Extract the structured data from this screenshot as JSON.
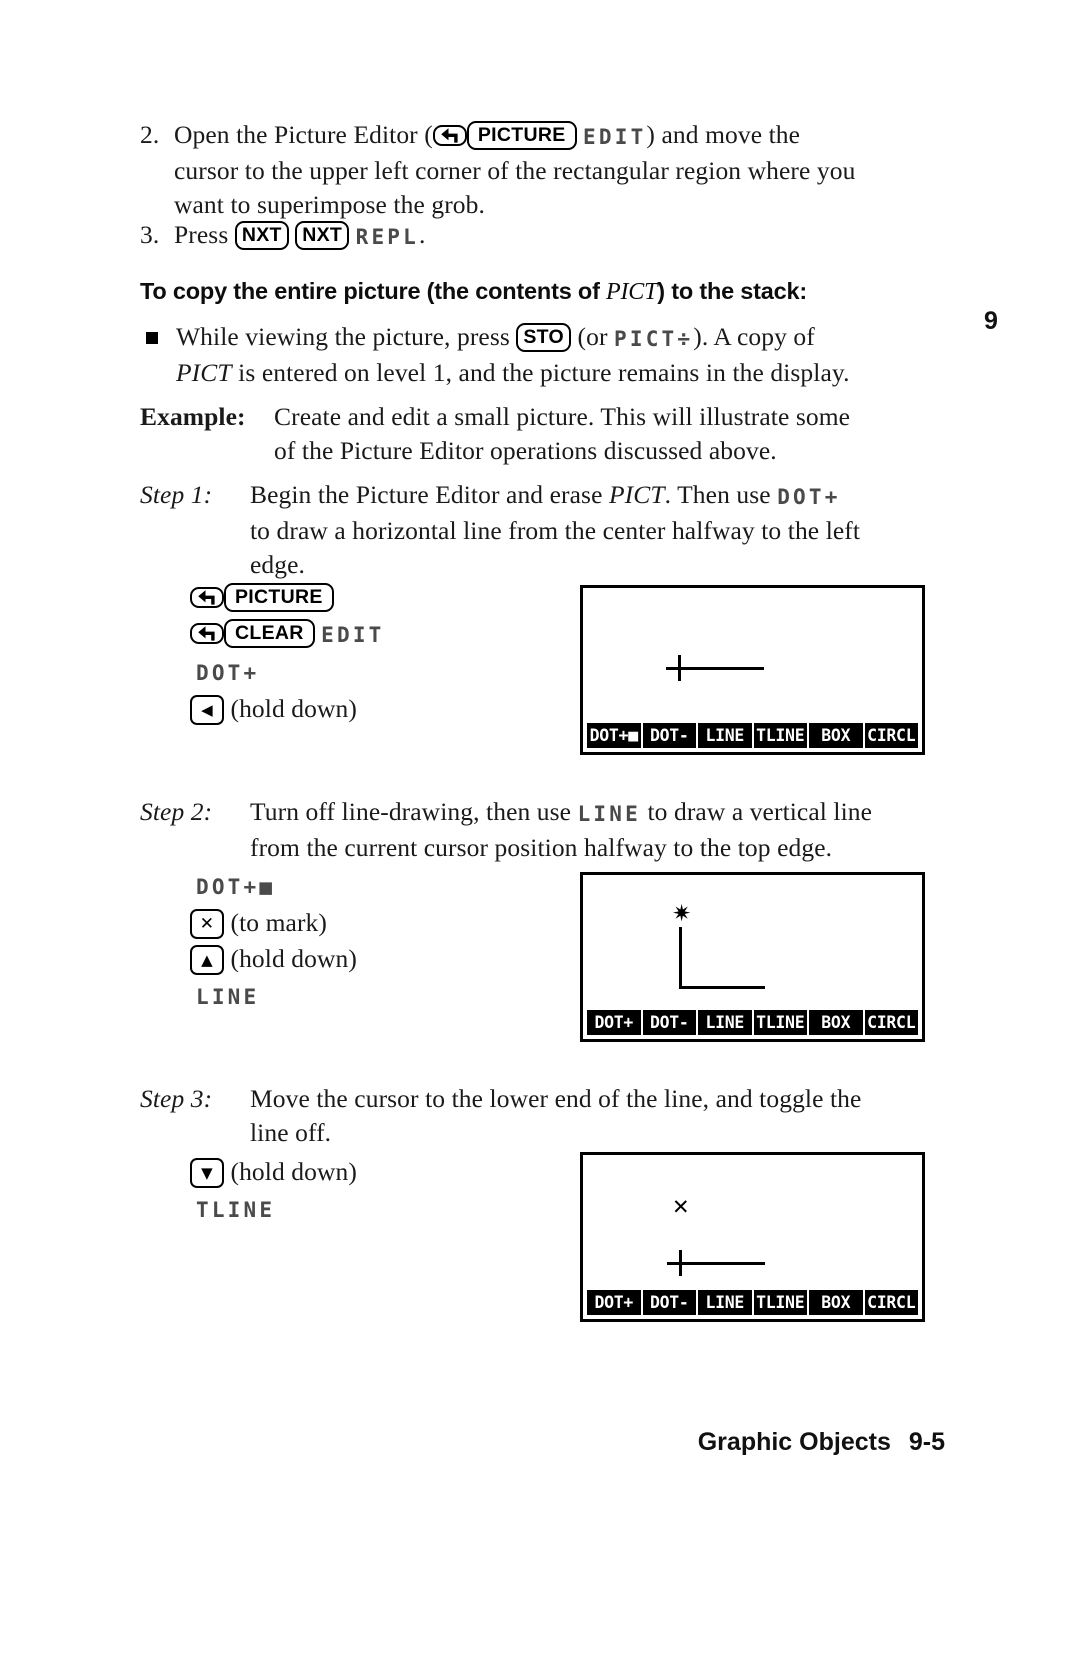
{
  "document": {
    "page_marker": "9",
    "footer_title": "Graphic Objects",
    "footer_page": "9-5"
  },
  "steps_top": {
    "item2": {
      "number": "2.",
      "text_before": "Open the Picture Editor (",
      "key_shift": "left-shift",
      "key_picture": "PICTURE",
      "soft_edit": "EDIT",
      "text_after": ") and move the",
      "line2": "cursor to the upper left corner of the rectangular region where you",
      "line3": "want to superimpose the grob."
    },
    "item3": {
      "number": "3.",
      "text_before": "Press",
      "key_nxt_1": "NXT",
      "key_nxt_2": "NXT",
      "soft_repl": "REPL",
      "text_after": "."
    }
  },
  "heading": {
    "part1": "To copy the entire picture (the contents of ",
    "italic": "PICT",
    "part2": ") to the stack:"
  },
  "bullet": {
    "line1_a": "While viewing the picture, press",
    "key_sto": "STO",
    "line1_b": "(or",
    "soft_pict_store": "PICT",
    "soft_pict_store_arrow": "÷",
    "line1_c": "). A copy of",
    "line2_italic": "PICT",
    "line2_rest": " is entered on level 1, and the picture remains in the display."
  },
  "example": {
    "label": "Example:",
    "line1": "Create and edit a small picture. This will illustrate some",
    "line2": "of the Picture Editor operations discussed above."
  },
  "step1": {
    "label": "Step 1:",
    "line1_a": "Begin the Picture Editor and erase ",
    "line1_italic": "PICT",
    "line1_b": ". Then use",
    "soft_dot_plus": "DOT+",
    "line2": "to draw a horizontal line from the center halfway to the left",
    "line3": "edge.",
    "keys": {
      "row1_shift": "left-shift",
      "row1_key": "PICTURE",
      "row2_shift": "left-shift",
      "row2_key": "CLEAR",
      "row2_soft": "EDIT",
      "row3_soft": "DOT+",
      "row4_key": "left-arrow",
      "row4_note": "(hold down)"
    },
    "display": {
      "menu": [
        "DOT+■",
        "DOT-",
        "LINE",
        "TLINE",
        "BOX",
        "CIRCL"
      ]
    }
  },
  "step2": {
    "label": "Step 2:",
    "line1_a": "Turn off line-drawing, then use",
    "soft_line": "LINE",
    "line1_b": "to draw a vertical line",
    "line2": "from the current cursor position halfway to the top edge.",
    "keys": {
      "row1_soft": "DOT+■",
      "row2_key": "x",
      "row2_note": "(to mark)",
      "row3_key": "up-arrow",
      "row3_note": "(hold down)",
      "row4_soft": "LINE"
    },
    "display": {
      "menu": [
        "DOT+",
        "DOT-",
        "LINE",
        "TLINE",
        "BOX",
        "CIRCL"
      ]
    }
  },
  "step3": {
    "label": "Step 3:",
    "line1": "Move the cursor to the lower end of the line, and toggle the",
    "line2": "line off.",
    "keys": {
      "row1_key": "down-arrow",
      "row1_note": "(hold down)",
      "row2_soft": "TLINE"
    },
    "display": {
      "menu": [
        "DOT+",
        "DOT-",
        "LINE",
        "TLINE",
        "BOX",
        "CIRCL"
      ]
    }
  }
}
